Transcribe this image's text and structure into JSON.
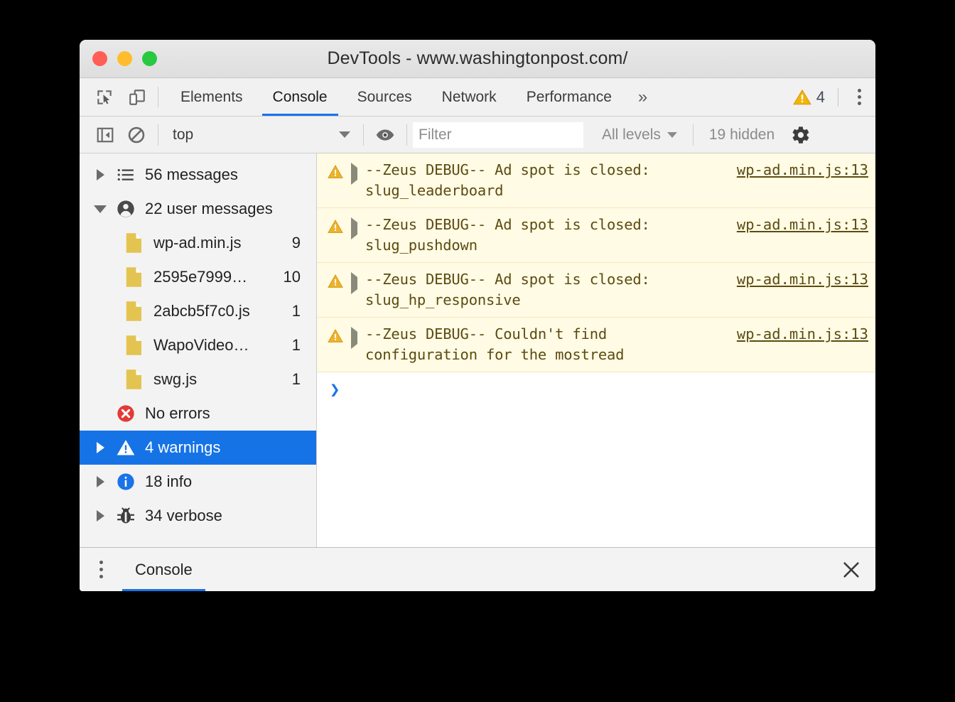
{
  "window": {
    "title": "DevTools - www.washingtonpost.com/",
    "traffic_lights": [
      "close",
      "minimize",
      "zoom"
    ]
  },
  "tabbar": {
    "inspect_icon": "inspect-element-icon",
    "device_icon": "device-toolbar-icon",
    "tabs": [
      {
        "label": "Elements",
        "active": false
      },
      {
        "label": "Console",
        "active": true
      },
      {
        "label": "Sources",
        "active": false
      },
      {
        "label": "Network",
        "active": false
      },
      {
        "label": "Performance",
        "active": false
      }
    ],
    "more_label": "»",
    "warning_count": "4",
    "warning_icon": "warning-triangle-icon",
    "menu_icon": "more-vertical-icon"
  },
  "toolbar": {
    "sidebar_toggle_icon": "show-console-sidebar-icon",
    "clear_icon": "clear-console-icon",
    "context_label": "top",
    "eye_icon": "live-expression-eye-icon",
    "filter_placeholder": "Filter",
    "filter_value": "",
    "levels_label": "All levels",
    "hidden_label": "19 hidden",
    "gear_icon": "settings-gear-icon"
  },
  "sidebar": {
    "items": [
      {
        "label": "56 messages",
        "count": "",
        "icon": "list-icon",
        "expanded": false,
        "selected": false,
        "child": false,
        "arrow": "right"
      },
      {
        "label": "22 user messages",
        "count": "",
        "icon": "user-icon",
        "expanded": true,
        "selected": false,
        "child": false,
        "arrow": "down"
      },
      {
        "label": "wp-ad.min.js",
        "count": "9",
        "icon": "js-file-icon",
        "selected": false,
        "child": true,
        "arrow": "none"
      },
      {
        "label": "2595e7999…",
        "count": "10",
        "icon": "js-file-icon",
        "selected": false,
        "child": true,
        "arrow": "none"
      },
      {
        "label": "2abcb5f7c0.js",
        "count": "1",
        "icon": "js-file-icon",
        "selected": false,
        "child": true,
        "arrow": "none"
      },
      {
        "label": "WapoVideo…",
        "count": "1",
        "icon": "js-file-icon",
        "selected": false,
        "child": true,
        "arrow": "none"
      },
      {
        "label": "swg.js",
        "count": "1",
        "icon": "js-file-icon",
        "selected": false,
        "child": true,
        "arrow": "none"
      },
      {
        "label": "No errors",
        "count": "",
        "icon": "error-circle-icon",
        "selected": false,
        "child": false,
        "arrow": "none"
      },
      {
        "label": "4 warnings",
        "count": "",
        "icon": "warning-triangle-icon",
        "selected": true,
        "child": false,
        "arrow": "right"
      },
      {
        "label": "18 info",
        "count": "",
        "icon": "info-circle-icon",
        "selected": false,
        "child": false,
        "arrow": "right"
      },
      {
        "label": "34 verbose",
        "count": "",
        "icon": "bug-icon",
        "selected": false,
        "child": false,
        "arrow": "right"
      }
    ]
  },
  "console": {
    "messages": [
      {
        "level": "warning",
        "text": "--Zeus DEBUG-- Ad spot is closed: slug_leaderboard",
        "source": "wp-ad.min.js:13"
      },
      {
        "level": "warning",
        "text": "--Zeus DEBUG-- Ad spot is closed: slug_pushdown",
        "source": "wp-ad.min.js:13"
      },
      {
        "level": "warning",
        "text": "--Zeus DEBUG-- Ad spot is closed: slug_hp_responsive",
        "source": "wp-ad.min.js:13"
      },
      {
        "level": "warning",
        "text": "--Zeus DEBUG-- Couldn't find configuration for the mostread",
        "source": "wp-ad.min.js:13"
      }
    ],
    "prompt_symbol": "❯",
    "prompt_value": ""
  },
  "drawer": {
    "menu_icon": "more-vertical-icon",
    "tabs": [
      {
        "label": "Console",
        "active": true
      }
    ],
    "close_icon": "close-icon"
  },
  "colors": {
    "accent": "#1a73e8",
    "selected_row": "#1673e6",
    "warning_bg": "#fffbe5",
    "warning_icon": "#e8ae2a",
    "warning_text": "#5c4b10",
    "error_red": "#e53935",
    "info_blue": "#1a73e8",
    "js_file_yellow": "#e3c451"
  }
}
